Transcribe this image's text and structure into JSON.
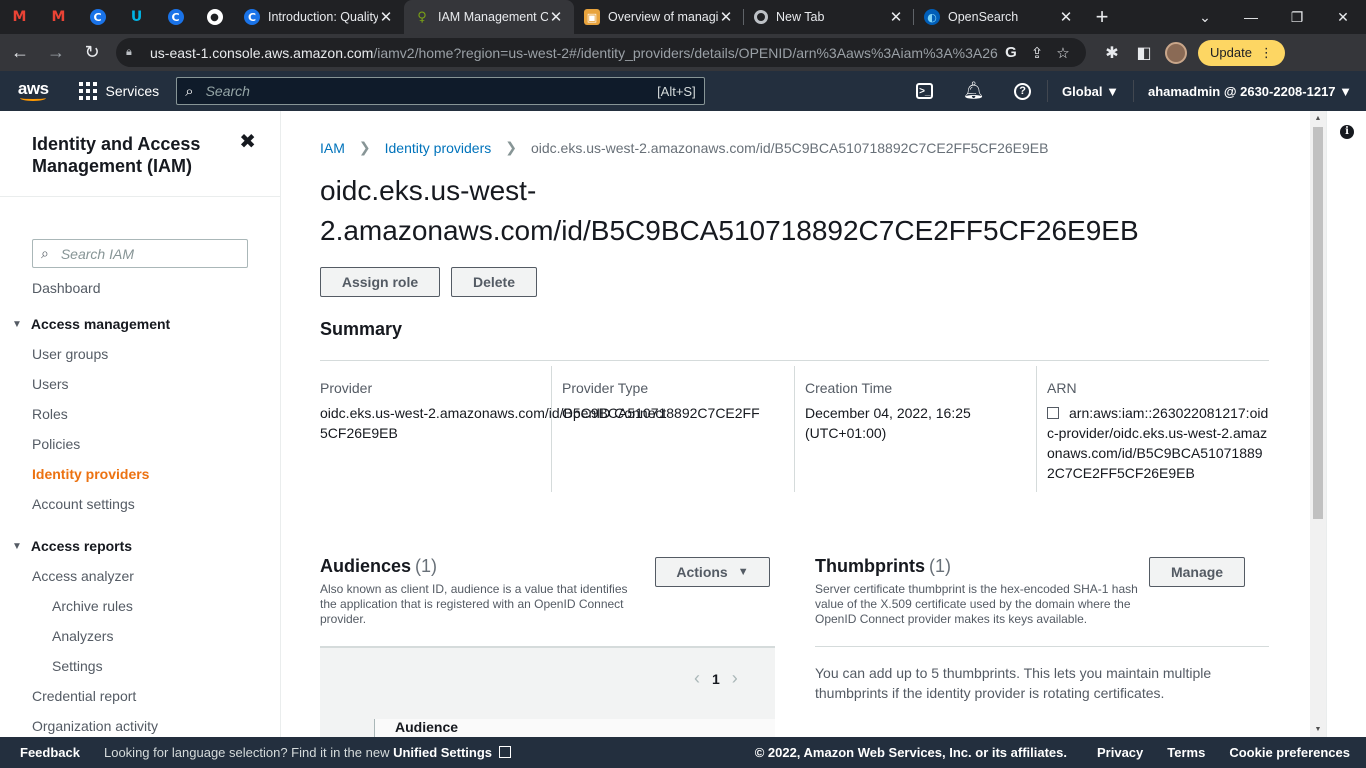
{
  "browser": {
    "pinned_tabs": [
      {
        "icon": "gmail-icon",
        "glyph": "M",
        "color": "#ea4335"
      },
      {
        "icon": "gmail-icon",
        "glyph": "M",
        "color": "#ea4335"
      },
      {
        "icon": "c-app-icon",
        "glyph": "C",
        "color": "#1a73e8"
      },
      {
        "icon": "u-app-icon",
        "glyph": "U",
        "color": "#00b4e5"
      },
      {
        "icon": "c-app-icon",
        "glyph": "C",
        "color": "#1a73e8"
      },
      {
        "icon": "github-icon",
        "glyph": "●",
        "color": "#ffffff"
      }
    ],
    "tabs": [
      {
        "title": "Introduction: Quality",
        "icon": "c-app-icon"
      },
      {
        "title": "IAM Management C",
        "icon": "aws-iam-icon"
      },
      {
        "title": "Overview of managi",
        "icon": "aws-box-icon"
      },
      {
        "title": "New Tab",
        "icon": "chrome-icon"
      },
      {
        "title": "OpenSearch",
        "icon": "opensearch-icon"
      }
    ],
    "url_host": "us-east-1.console.aws.amazon.com",
    "url_path": "/iamv2/home?region=us-west-2#/identity_providers/details/OPENID/arn%3Aaws%3Aiam%3A%3A263022081217...",
    "update_label": "Update"
  },
  "aws_nav": {
    "logo": "aws",
    "services_label": "Services",
    "search_placeholder": "Search",
    "search_shortcut": "[Alt+S]",
    "region": "Global ▼",
    "account": "ahamadmin @ 2630-2208-1217 ▼"
  },
  "sidebar": {
    "title": "Identity and Access Management (IAM)",
    "search_placeholder": "Search IAM",
    "dashboard": "Dashboard",
    "access_management": {
      "heading": "Access management",
      "items": [
        "User groups",
        "Users",
        "Roles",
        "Policies",
        "Identity providers",
        "Account settings"
      ]
    },
    "access_reports": {
      "heading": "Access reports",
      "items": [
        "Access analyzer",
        "Archive rules",
        "Analyzers",
        "Settings",
        "Credential report",
        "Organization activity"
      ]
    }
  },
  "main": {
    "breadcrumb": {
      "root": "IAM",
      "parent": "Identity providers",
      "current": "oidc.eks.us-west-2.amazonaws.com/id/B5C9BCA510718892C7CE2FF5CF26E9EB"
    },
    "title_line1": "oidc.eks.us-west-",
    "title_line2": "2.amazonaws.com/id/B5C9BCA510718892C7CE2FF5CF26E9EB",
    "assign_role": "Assign role",
    "delete": "Delete",
    "summary": {
      "heading": "Summary",
      "provider_label": "Provider",
      "provider_value": "oidc.eks.us-west-2.amazonaws.com/id/B5C9BCA510718892C7CE2FF5CF26E9EB",
      "type_label": "Provider Type",
      "type_value": "OpenID Connect",
      "created_label": "Creation Time",
      "created_value": "December 04, 2022, 16:25 (UTC+01:00)",
      "arn_label": "ARN",
      "arn_value": "arn:aws:iam::263022081217:oidc-provider/oidc.eks.us-west-2.amazonaws.com/id/B5C9BCA510718892C7CE2FF5CF26E9EB"
    },
    "audiences": {
      "heading": "Audiences",
      "count": "(1)",
      "description": "Also known as client ID, audience is a value that identifies the application that is registered with an OpenID Connect provider.",
      "actions_label": "Actions",
      "page": "1",
      "column_header": "Audience"
    },
    "thumbprints": {
      "heading": "Thumbprints",
      "count": "(1)",
      "description": "Server certificate thumbprint is the hex-encoded SHA-1 hash value of the X.509 certificate used by the domain where the OpenID Connect provider makes its keys available.",
      "manage_label": "Manage",
      "info": "You can add up to 5 thumbprints. This lets you maintain multiple thumbprints if the identity provider is rotating certificates."
    }
  },
  "footer": {
    "feedback": "Feedback",
    "lang_prefix": "Looking for language selection? Find it in the new",
    "lang_link": "Unified Settings",
    "copyright": "© 2022, Amazon Web Services, Inc. or its affiliates.",
    "privacy": "Privacy",
    "terms": "Terms",
    "cookies": "Cookie preferences"
  },
  "colors": {
    "aws_nav": "#232f3e",
    "active_link": "#ec7211",
    "link": "#0073bb",
    "update_badge": "#fdd663"
  }
}
